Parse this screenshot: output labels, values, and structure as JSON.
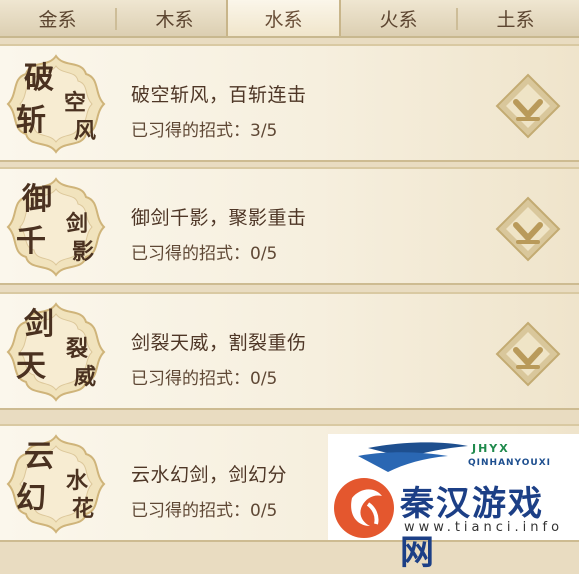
{
  "tabs": [
    {
      "label": "金系",
      "active": false
    },
    {
      "label": "木系",
      "active": false
    },
    {
      "label": "水系",
      "active": true
    },
    {
      "label": "火系",
      "active": false
    },
    {
      "label": "土系",
      "active": false
    }
  ],
  "skills": [
    {
      "emblem": {
        "col1": [
          "破",
          "斩"
        ],
        "col2": [
          "空",
          "风"
        ]
      },
      "title": "破空斩风，百斩连击",
      "learned": "已习得的招式：3/5"
    },
    {
      "emblem": {
        "col1": [
          "御",
          "千"
        ],
        "col2": [
          "剑",
          "影"
        ]
      },
      "title": "御剑千影，聚影重击",
      "learned": "已习得的招式：0/5"
    },
    {
      "emblem": {
        "col1": [
          "剑",
          "天"
        ],
        "col2": [
          "裂",
          "威"
        ]
      },
      "title": "剑裂天威，割裂重伤",
      "learned": "已习得的招式：0/5"
    },
    {
      "emblem": {
        "col1": [
          "云",
          "幻"
        ],
        "col2": [
          "水",
          "花"
        ]
      },
      "title": "云水幻剑，剑幻分",
      "learned": "已习得的招式：0/5"
    }
  ],
  "watermark": {
    "badge": "JHYX",
    "brand_pinyin": "QINHANYOUXI",
    "brand_name": "秦汉游戏网",
    "url": "www.tianci.info"
  },
  "colors": {
    "accent_gold": "#c9b27a",
    "text_brown": "#4e3626",
    "tab_bar": "#e2d6bb"
  }
}
